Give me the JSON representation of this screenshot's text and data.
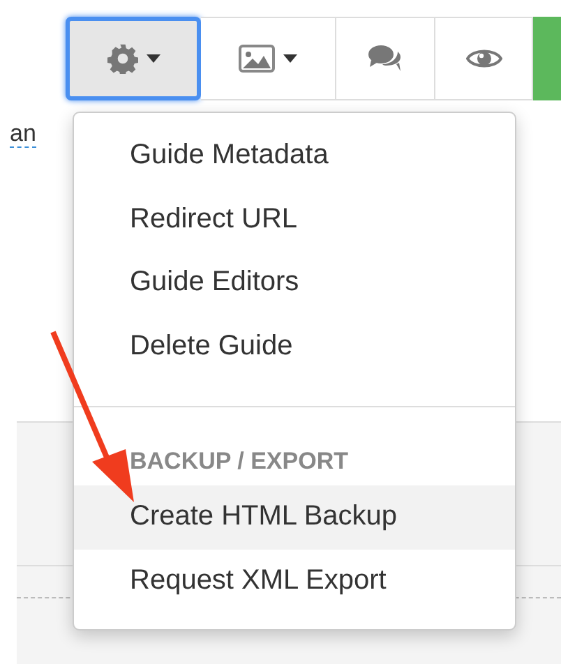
{
  "toolbar": [
    {
      "kind": "gear",
      "dropdown": true,
      "selected": true
    },
    {
      "kind": "image",
      "dropdown": true,
      "selected": false
    },
    {
      "kind": "chat",
      "dropdown": false,
      "selected": false
    },
    {
      "kind": "eye",
      "dropdown": false,
      "selected": false
    }
  ],
  "page_text": "an",
  "menu": {
    "items": [
      {
        "kind": "item",
        "label": "Guide Metadata",
        "selected": false
      },
      {
        "kind": "item",
        "label": "Redirect URL",
        "selected": false
      },
      {
        "kind": "item",
        "label": "Guide Editors",
        "selected": false
      },
      {
        "kind": "item",
        "label": "Delete Guide",
        "selected": false
      },
      {
        "kind": "divider"
      },
      {
        "kind": "header",
        "label": "BACKUP / EXPORT"
      },
      {
        "kind": "item",
        "label": "Create HTML Backup",
        "selected": true
      },
      {
        "kind": "item",
        "label": "Request XML Export",
        "selected": false
      }
    ]
  }
}
